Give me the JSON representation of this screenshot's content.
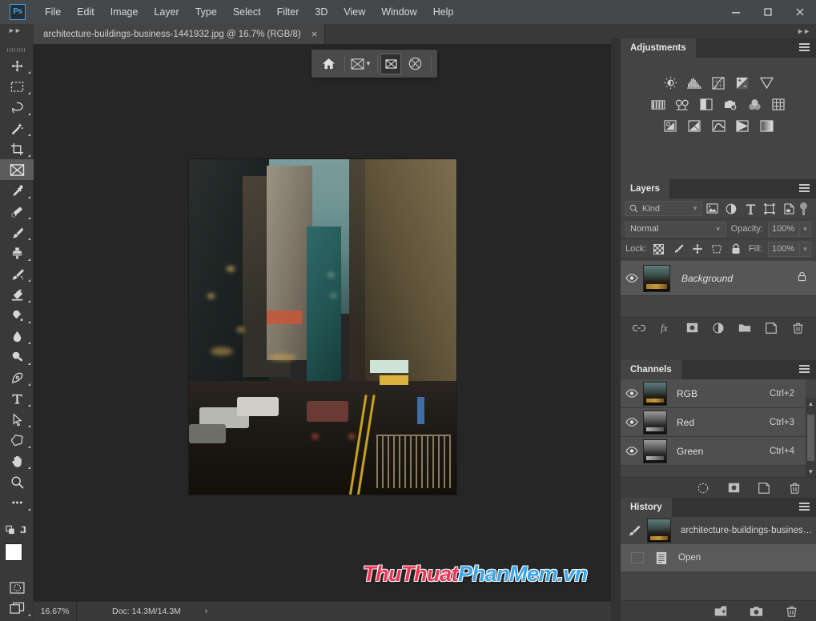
{
  "app": {
    "logo": "Ps"
  },
  "menubar": {
    "items": [
      "File",
      "Edit",
      "Image",
      "Layer",
      "Type",
      "Select",
      "Filter",
      "3D",
      "View",
      "Window",
      "Help"
    ]
  },
  "window_controls": {
    "minimize": "minimize-icon",
    "maximize": "maximize-icon",
    "close": "close-icon"
  },
  "document_tab": {
    "title": "architecture-buildings-business-1441932.jpg @ 16.7% (RGB/8)",
    "close": "×"
  },
  "toolbar": {
    "tools": [
      {
        "name": "move-tool",
        "label": "Move Tool"
      },
      {
        "name": "marquee-tool",
        "label": "Rectangular Marquee Tool"
      },
      {
        "name": "lasso-tool",
        "label": "Lasso Tool"
      },
      {
        "name": "magic-wand-tool",
        "label": "Object Selection Tool"
      },
      {
        "name": "crop-tool",
        "label": "Crop Tool"
      },
      {
        "name": "frame-tool",
        "label": "Frame Tool"
      },
      {
        "name": "eyedropper-tool",
        "label": "Eyedropper Tool"
      },
      {
        "name": "healing-brush-tool",
        "label": "Spot Healing Brush Tool"
      },
      {
        "name": "brush-tool",
        "label": "Brush Tool"
      },
      {
        "name": "clone-stamp-tool",
        "label": "Clone Stamp Tool"
      },
      {
        "name": "history-brush-tool",
        "label": "History Brush Tool"
      },
      {
        "name": "eraser-tool",
        "label": "Eraser Tool"
      },
      {
        "name": "gradient-tool",
        "label": "Gradient Tool"
      },
      {
        "name": "blur-tool",
        "label": "Blur Tool"
      },
      {
        "name": "dodge-tool",
        "label": "Dodge Tool"
      },
      {
        "name": "pen-tool",
        "label": "Pen Tool"
      },
      {
        "name": "type-tool",
        "label": "Horizontal Type Tool"
      },
      {
        "name": "path-selection-tool",
        "label": "Path Selection Tool"
      },
      {
        "name": "shape-tool",
        "label": "Custom Shape Tool"
      },
      {
        "name": "hand-tool",
        "label": "Hand Tool"
      },
      {
        "name": "zoom-tool",
        "label": "Zoom Tool"
      },
      {
        "name": "edit-toolbar-tool",
        "label": "Edit Toolbar"
      }
    ],
    "active_tool": "frame-tool",
    "foreground_color": "#ffffff",
    "background_color": "#ffffff",
    "quick_mask": "Edit in Quick Mask Mode",
    "screen_mode": "Change Screen Mode"
  },
  "options_bar": {
    "buttons": [
      {
        "name": "home-button",
        "icon": "home-icon"
      },
      {
        "name": "frame-preset-button",
        "icon": "frame-icon"
      },
      {
        "name": "rectangle-frame-button",
        "icon": "rectangle-frame-icon"
      },
      {
        "name": "ellipse-frame-button",
        "icon": "ellipse-frame-icon"
      }
    ]
  },
  "statusbar": {
    "zoom": "16.67%",
    "doc_info": "Doc: 14.3M/14.3M",
    "expand": "›"
  },
  "watermark": {
    "part1": "ThuThuat",
    "part2": "PhanMem.vn",
    "color1": "#ee3355",
    "color2": "#3aa5e8"
  },
  "panels": {
    "adjustments": {
      "tab": "Adjustments",
      "menu": "panel-menu-icon",
      "row1": [
        "brightness-contrast-icon",
        "levels-icon",
        "curves-icon",
        "exposure-icon",
        "vibrance-icon"
      ],
      "row2": [
        "hue-saturation-icon",
        "color-balance-icon",
        "black-white-icon",
        "photo-filter-icon",
        "channel-mixer-icon",
        "color-lookup-icon"
      ],
      "row3": [
        "invert-icon",
        "posterize-icon",
        "threshold-icon",
        "gradient-map-icon",
        "selective-color-icon"
      ]
    },
    "layers": {
      "tab": "Layers",
      "menu": "panel-menu-icon",
      "filter_kind": "Kind",
      "filter_icons": [
        "pixel-filter-icon",
        "adjustment-filter-icon",
        "type-filter-icon",
        "shape-filter-icon",
        "smart-object-filter-icon"
      ],
      "filter_toggle": "filter-toggle-switch",
      "blend_mode": "Normal",
      "opacity_label": "Opacity:",
      "opacity_value": "100%",
      "lock_label": "Lock:",
      "lock_icons": [
        "lock-transparent-pixels-icon",
        "lock-image-pixels-icon",
        "lock-position-icon",
        "lock-artboard-nesting-icon",
        "lock-all-icon"
      ],
      "fill_label": "Fill:",
      "fill_value": "100%",
      "rows": [
        {
          "name": "Background",
          "visible": true,
          "locked": true
        }
      ],
      "footer_icons": [
        "link-layers-icon",
        "layer-style-fx-icon",
        "layer-mask-icon",
        "adjustment-layer-icon",
        "new-group-icon",
        "new-layer-icon",
        "delete-layer-icon"
      ]
    },
    "channels": {
      "tab": "Channels",
      "menu": "panel-menu-icon",
      "rows": [
        {
          "name": "RGB",
          "shortcut": "Ctrl+2",
          "visible": true
        },
        {
          "name": "Red",
          "shortcut": "Ctrl+3",
          "visible": true
        },
        {
          "name": "Green",
          "shortcut": "Ctrl+4",
          "visible": true
        }
      ],
      "footer_icons": [
        "load-channel-as-selection-icon",
        "save-selection-as-channel-icon",
        "new-channel-icon",
        "delete-channel-icon"
      ]
    },
    "history": {
      "tab": "History",
      "menu": "panel-menu-icon",
      "snapshot": {
        "label": "architecture-buildings-business-...",
        "icon": "history-brush-source-icon"
      },
      "states": [
        {
          "label": "Open",
          "icon": "open-document-icon",
          "selected": true
        }
      ],
      "footer_icons": [
        "create-document-from-state-icon",
        "create-new-snapshot-icon",
        "delete-state-icon"
      ]
    }
  },
  "canvas": {
    "image_alt": "architecture-buildings-business street photo",
    "zoom_percent": "16.7%",
    "color_mode": "RGB/8"
  }
}
